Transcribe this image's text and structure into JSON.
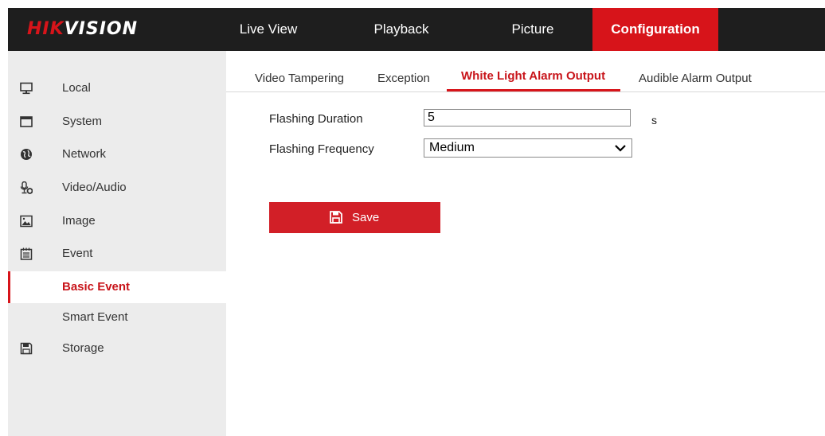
{
  "brand": {
    "part1": "HIK",
    "part2": "VISION"
  },
  "nav": {
    "items": [
      {
        "label": "Live View"
      },
      {
        "label": "Playback"
      },
      {
        "label": "Picture"
      },
      {
        "label": "Configuration",
        "active": true
      }
    ]
  },
  "sidebar": {
    "items": [
      {
        "label": "Local",
        "icon": "monitor-icon"
      },
      {
        "label": "System",
        "icon": "window-icon"
      },
      {
        "label": "Network",
        "icon": "globe-icon"
      },
      {
        "label": "Video/Audio",
        "icon": "microphone-icon"
      },
      {
        "label": "Image",
        "icon": "picture-icon"
      },
      {
        "label": "Event",
        "icon": "calendar-icon"
      },
      {
        "label": "Basic Event",
        "active": true
      },
      {
        "label": "Smart Event"
      },
      {
        "label": "Storage",
        "icon": "floppy-icon"
      }
    ]
  },
  "tabs": [
    {
      "label": "Video Tampering"
    },
    {
      "label": "Exception"
    },
    {
      "label": "White Light Alarm Output",
      "active": true
    },
    {
      "label": "Audible Alarm Output"
    }
  ],
  "form": {
    "duration_label": "Flashing Duration",
    "duration_value": "5",
    "duration_unit": "s",
    "frequency_label": "Flashing Frequency",
    "frequency_value": "Medium"
  },
  "save_label": "Save",
  "colors": {
    "accent": "#d7141a",
    "topbar": "#1e1e1e",
    "sidebar": "#ececec"
  }
}
